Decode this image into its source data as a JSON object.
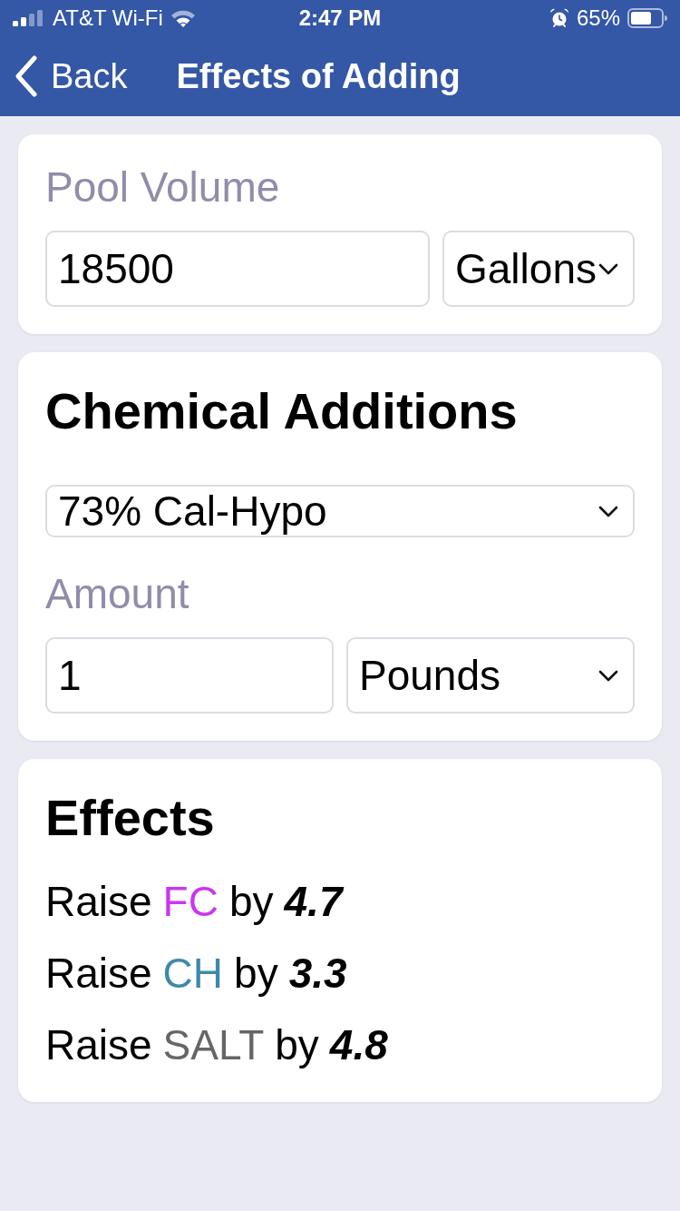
{
  "status_bar": {
    "carrier": "AT&T Wi-Fi",
    "time": "2:47 PM",
    "battery": "65%"
  },
  "nav_bar": {
    "back": "Back",
    "title": "Effects of Adding"
  },
  "pool_volume": {
    "label": "Pool Volume",
    "value": "18500",
    "unit": "Gallons"
  },
  "chemical_additions": {
    "title": "Chemical Additions",
    "chemical": "73% Cal-Hypo",
    "amount_label": "Amount",
    "amount": "1",
    "amount_unit": "Pounds"
  },
  "effects": {
    "title": "Effects",
    "rows": [
      {
        "verb": "Raise",
        "parameter": "FC",
        "color": "#c936f2",
        "preposition": "by",
        "value": "4.7"
      },
      {
        "verb": "Raise",
        "parameter": "CH",
        "color": "#3f88aa",
        "preposition": "by",
        "value": "3.3"
      },
      {
        "verb": "Raise",
        "parameter": "SALT",
        "color": "#666666",
        "preposition": "by",
        "value": "4.8"
      }
    ]
  }
}
